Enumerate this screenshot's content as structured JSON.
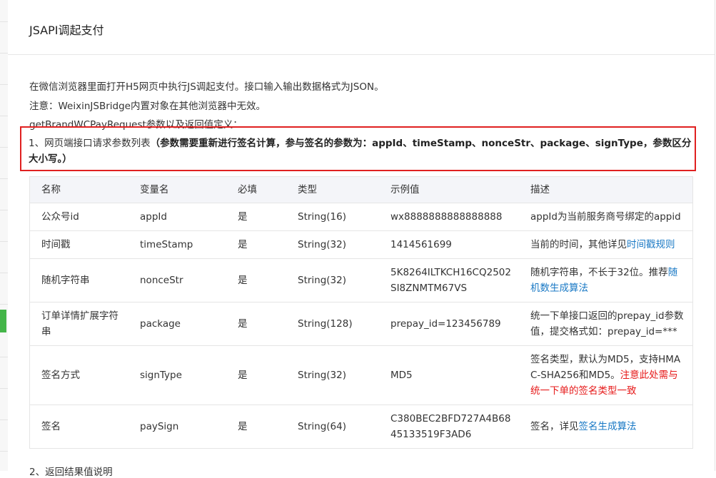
{
  "header": {
    "title": "JSAPI调起支付"
  },
  "intro": {
    "line1": "在微信浏览器里面打开H5网页中执行JS调起支付。接口输入输出数据格式为JSON。",
    "line2": "注意：WeixinJSBridge内置对象在其他浏览器中无效。",
    "line3": "getBrandWCPayRequest参数以及返回值定义："
  },
  "alert": {
    "prefix": "1、网页端接口请求参数列表",
    "bold": "（参数需要重新进行签名计算，参与签名的参数为：appId、timeStamp、nonceStr、package、signType，参数区分大小写。）"
  },
  "table": {
    "headers": [
      "名称",
      "变量名",
      "必填",
      "类型",
      "示例值",
      "描述"
    ],
    "rows": [
      {
        "name": "公众号id",
        "var": "appId",
        "required": "是",
        "type": "String(16)",
        "example": "wx8888888888888888",
        "desc": "appId为当前服务商号绑定的appid"
      },
      {
        "name": "时间戳",
        "var": "timeStamp",
        "required": "是",
        "type": "String(32)",
        "example": "1414561699",
        "desc": "当前的时间，其他详见",
        "desc_link": "时间戳规则"
      },
      {
        "name": "随机字符串",
        "var": "nonceStr",
        "required": "是",
        "type": "String(32)",
        "example": "5K8264ILTKCH16CQ2502SI8ZNMTM67VS",
        "desc": "随机字符串，不长于32位。推荐",
        "desc_link": "随机数生成算法"
      },
      {
        "name": "订单详情扩展字符串",
        "var": "package",
        "required": "是",
        "type": "String(128)",
        "example": "prepay_id=123456789",
        "desc": "统一下单接口返回的prepay_id参数值，提交格式如：prepay_id=***"
      },
      {
        "name": "签名方式",
        "var": "signType",
        "required": "是",
        "type": "String(32)",
        "example": "MD5",
        "desc": "签名类型，默认为MD5，支持HMAC-SHA256和MD5。",
        "desc_red": "注意此处需与统一下单的签名类型一致"
      },
      {
        "name": "签名",
        "var": "paySign",
        "required": "是",
        "type": "String(64)",
        "example": "C380BEC2BFD727A4B6845133519F3AD6",
        "desc": "签名，详见",
        "desc_link": "签名生成算法"
      }
    ]
  },
  "footer": {
    "line": "2、返回结果值说明"
  },
  "colors": {
    "accent_link": "#1a79c5",
    "alert_border": "#e02020",
    "red_text": "#e61919",
    "green_bar": "#44b549"
  }
}
